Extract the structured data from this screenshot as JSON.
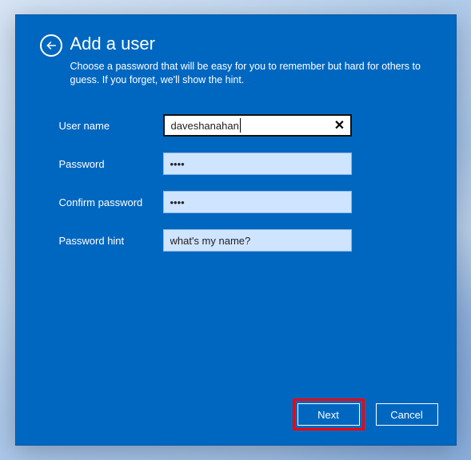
{
  "dialog": {
    "title": "Add a user",
    "subtitle": "Choose a password that will be easy for you to remember but hard for others to guess. If you forget, we'll show the hint."
  },
  "fields": {
    "username": {
      "label": "User name",
      "value": "daveshanahan"
    },
    "password": {
      "label": "Password",
      "value": "••••"
    },
    "confirm": {
      "label": "Confirm password",
      "value": "••••"
    },
    "hint": {
      "label": "Password hint",
      "value": "what's my name?"
    }
  },
  "buttons": {
    "next": "Next",
    "cancel": "Cancel"
  },
  "icons": {
    "back": "back-arrow",
    "clear": "✕"
  }
}
